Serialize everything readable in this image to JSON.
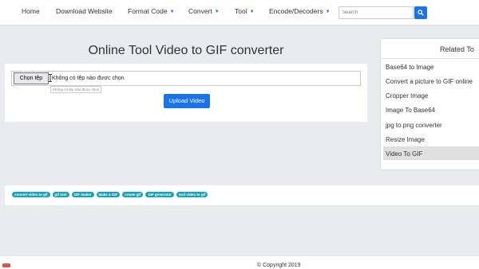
{
  "nav": {
    "home": "Home",
    "download": "Download Website",
    "format_code": "Format Code",
    "convert": "Convert",
    "tool": "Tool",
    "encode": "Encode/Decoders",
    "caret": "▼",
    "search_placeholder": "Search"
  },
  "main": {
    "title": "Online Tool Video to GIF converter",
    "choose_file": "Chọn tệp",
    "file_status": "Không có tệp nào được chọn",
    "tooltip": "Không có tệp nào được chọn",
    "upload": "Upload Video"
  },
  "sidebar": {
    "title": "Related To",
    "items": [
      {
        "label": "Base64 to Image"
      },
      {
        "label": "Convert a picture to GIF online"
      },
      {
        "label": "Cropper Image"
      },
      {
        "label": "Image To Base64"
      },
      {
        "label": "jpg to png converter"
      },
      {
        "label": "Resize Image"
      },
      {
        "label": "Video To GIF"
      }
    ]
  },
  "tags": [
    "convert video to gif",
    "gif tool",
    "GIF maker",
    "Make a GIF",
    "create gif",
    "GIF generator",
    "tool video to gif"
  ],
  "footer": {
    "copyright": "© Copyright 2019"
  },
  "colors": {
    "accent": "#1a73e8",
    "tag": "#17a2b8",
    "background": "#e9ebee"
  }
}
